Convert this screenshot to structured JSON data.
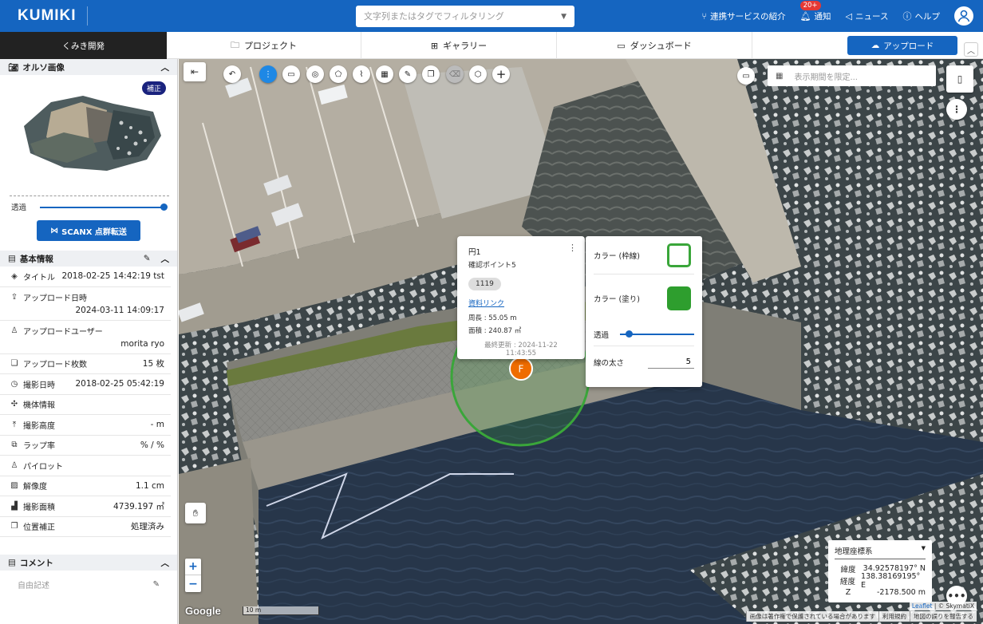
{
  "header": {
    "logo": "KUMIKI",
    "search_placeholder": "文字列またはタグでフィルタリング",
    "links": [
      {
        "label": "連携サービスの紹介",
        "icon": "share-icon"
      },
      {
        "label": "通知",
        "icon": "bell-icon",
        "badge": "20+"
      },
      {
        "label": "ニュース",
        "icon": "megaphone-icon"
      },
      {
        "label": "ヘルプ",
        "icon": "help-icon"
      }
    ]
  },
  "nav": {
    "workspace": "くみき開発",
    "tabs": [
      {
        "label": "プロジェクト",
        "icon": "folder-icon"
      },
      {
        "label": "ギャラリー",
        "icon": "grid-icon"
      },
      {
        "label": "ダッシュボード",
        "icon": "monitor-icon"
      }
    ],
    "upload_label": "アップロード"
  },
  "sidebar": {
    "ortho": {
      "title": "オルソ画像",
      "badge": "補正",
      "opacity_label": "透過",
      "opacity": 1.0,
      "scanx_label": "SCANX 点群転送"
    },
    "basic_info": {
      "title": "基本情報",
      "rows": [
        {
          "label": "タイトル",
          "value": "2018-02-25 14:42:19 tst",
          "icon": "layers-icon",
          "tall": false
        },
        {
          "label": "アップロード日時",
          "value": "2024-03-11 14:09:17",
          "icon": "upload-icon",
          "tall": true
        },
        {
          "label": "アップロードユーザー",
          "value": "morita ryo",
          "icon": "user-icon",
          "tall": true
        },
        {
          "label": "アップロード枚数",
          "value": "15 枚",
          "icon": "images-icon",
          "tall": false
        },
        {
          "label": "撮影日時",
          "value": "2018-02-25 05:42:19",
          "icon": "clock-icon",
          "tall": false
        },
        {
          "label": "機体情報",
          "value": "",
          "icon": "drone-icon",
          "tall": false
        },
        {
          "label": "撮影高度",
          "value": "- m",
          "icon": "altitude-icon",
          "tall": false
        },
        {
          "label": "ラップ率",
          "value": "% / %",
          "icon": "overlap-icon",
          "tall": false
        },
        {
          "label": "パイロット",
          "value": "",
          "icon": "pilot-icon",
          "tall": false
        },
        {
          "label": "解像度",
          "value": "1.1 cm",
          "icon": "image-icon",
          "tall": false
        },
        {
          "label": "撮影面積",
          "value": "4739.197 ㎡",
          "icon": "area-icon",
          "tall": false
        },
        {
          "label": "位置補正",
          "value": "処理済み",
          "icon": "copy-icon",
          "tall": false
        }
      ]
    },
    "comment": {
      "title": "コメント",
      "placeholder": "自由記述"
    }
  },
  "map": {
    "date_filter_placeholder": "表示期間を限定...",
    "popup": {
      "title": "円1",
      "subtitle": "確認ポイント5",
      "chip": "1119",
      "link": "資料リンク",
      "perimeter": "周長 : 55.05 m",
      "area": "面積 : 240.87 ㎡",
      "updated": "最終更新 : 2024-11-22 11:43:55"
    },
    "marker_label": "F",
    "style_panel": {
      "stroke_color_label": "カラー (枠線)",
      "fill_color_label": "カラー (塗り)",
      "opacity_label": "透過",
      "opacity": 0.12,
      "width_label": "線の太さ",
      "width_value": "5",
      "stroke_color": "#3aa63a",
      "fill_color": "#2e9e2e"
    },
    "coords": {
      "system": "地理座標系",
      "lat_label": "緯度",
      "lat": "34.92578197° N",
      "lon_label": "経度",
      "lon": "138.38169195° E",
      "z_label": "Z",
      "z": "-2178.500 m"
    },
    "google": "Google",
    "scale": "10 m",
    "leaflet": "Leaflet",
    "skymatix": "| © SkymatiX",
    "terms": [
      "画像は著作権で保護されている場合があります",
      "利用規約",
      "地図の誤りを報告する"
    ]
  },
  "colors": {
    "primary": "#1565c0",
    "dark": "#222222"
  }
}
